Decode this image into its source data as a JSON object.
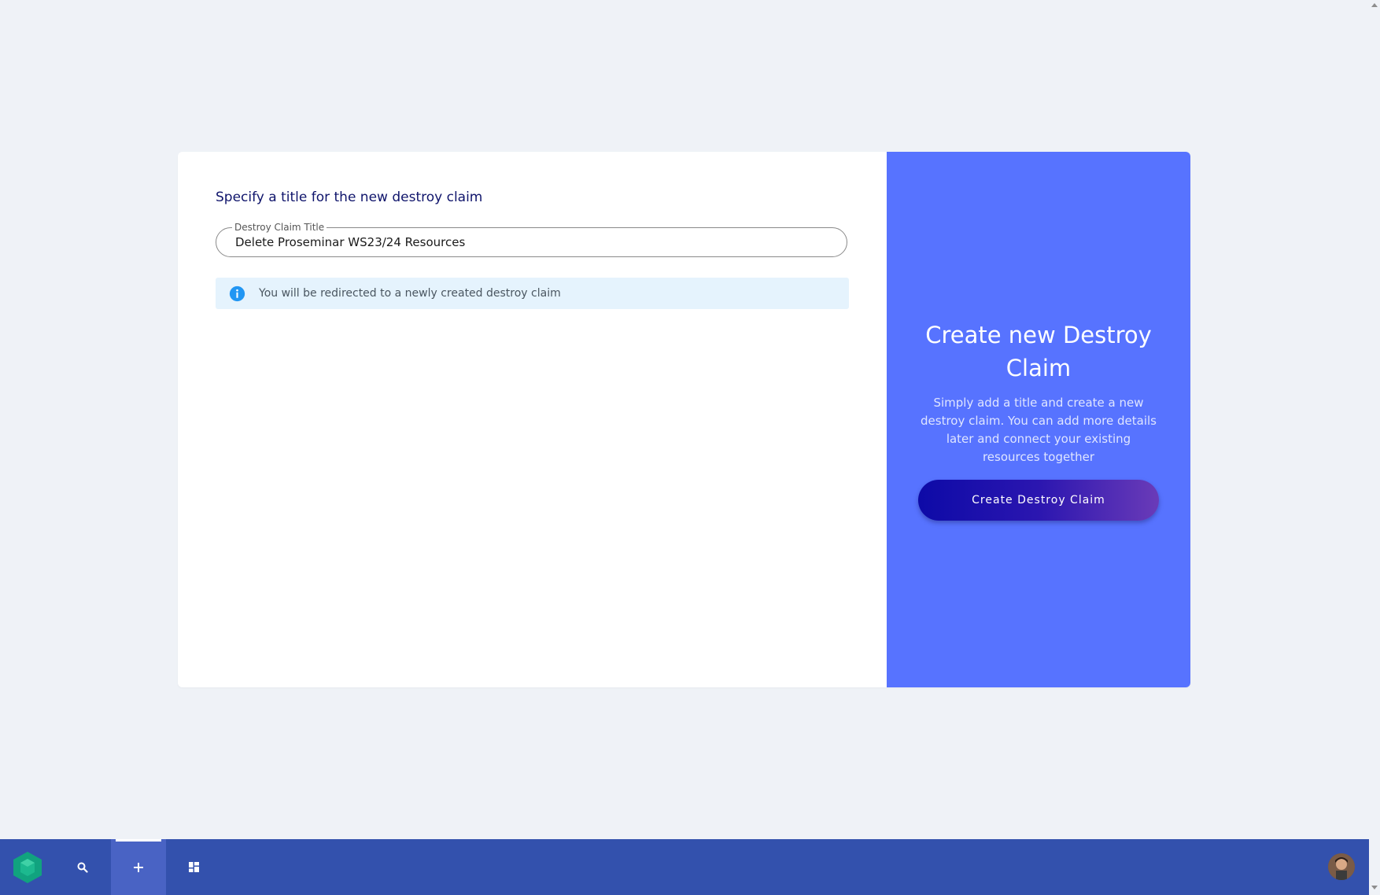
{
  "form": {
    "heading": "Specify a title for the new destroy claim",
    "title_field": {
      "label": "Destroy Claim Title",
      "value": "Delete Proseminar WS23/24 Resources"
    },
    "info_alert": {
      "icon": "info-icon",
      "text": "You will be redirected to a newly created destroy claim"
    }
  },
  "promo": {
    "title": "Create new Destroy Claim",
    "description": "Simply add a title and create a new destroy claim. You can add more details later and connect your existing resources together",
    "button_label": "Create Destroy Claim"
  },
  "taskbar": {
    "items": [
      {
        "icon": "logo-icon"
      },
      {
        "icon": "search-icon"
      },
      {
        "icon": "plus-icon",
        "active": true
      },
      {
        "icon": "dashboard-icon"
      }
    ],
    "avatar": "user-avatar"
  },
  "colors": {
    "page_background": "#eff2f7",
    "promo_background": "#5773ff",
    "taskbar_background": "#3351ad",
    "heading": "#0f146b",
    "info_background": "#e5f3fd",
    "info_icon": "#2196f3"
  }
}
